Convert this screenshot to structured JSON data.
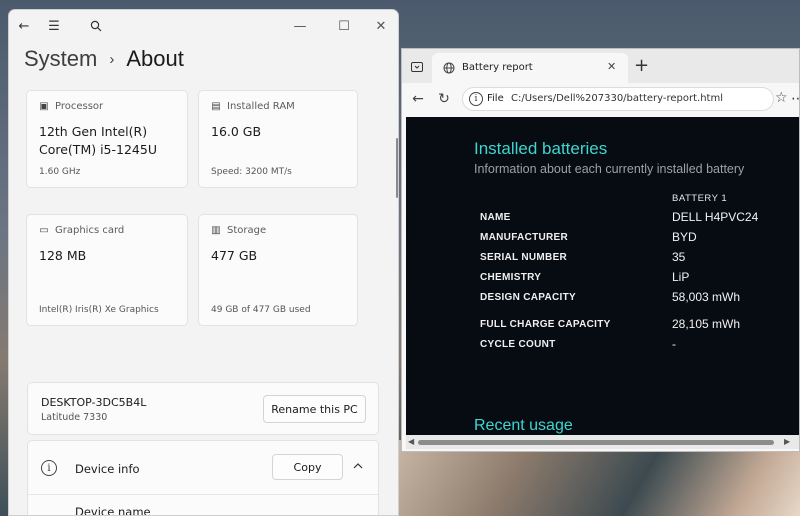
{
  "settings": {
    "breadcrumb_parent": "System",
    "breadcrumb_sep": "›",
    "breadcrumb_current": "About",
    "processor": {
      "label": "Processor",
      "value_line1": "12th Gen Intel(R)",
      "value_line2": "Core(TM) i5-1245U",
      "sub": "1.60 GHz"
    },
    "ram": {
      "label": "Installed RAM",
      "value": "16.0 GB",
      "sub": "Speed: 3200 MT/s"
    },
    "graphics": {
      "label": "Graphics card",
      "value": "128 MB",
      "sub": "Intel(R) Iris(R) Xe Graphics"
    },
    "storage": {
      "label": "Storage",
      "value": "477 GB",
      "sub": "49 GB of 477 GB used"
    },
    "pc_name": "DESKTOP-3DC5B4L",
    "pc_model": "Latitude 7330",
    "rename_button": "Rename this PC",
    "device_info_title": "Device info",
    "copy_button": "Copy",
    "device_name_label": "Device name"
  },
  "browser": {
    "tab_title": "Battery report",
    "address_protocol": "File",
    "address_url": "C:/Users/Dell%207330/battery-report.html",
    "page": {
      "heading": "Installed batteries",
      "subtitle": "Information about each currently installed battery",
      "battery_column": "BATTERY 1",
      "rows": [
        {
          "label": "NAME",
          "value": "DELL H4PVC24"
        },
        {
          "label": "MANUFACTURER",
          "value": "BYD"
        },
        {
          "label": "SERIAL NUMBER",
          "value": "35"
        },
        {
          "label": "CHEMISTRY",
          "value": "LiP"
        },
        {
          "label": "DESIGN CAPACITY",
          "value": "58,003 mWh"
        },
        {
          "label": "FULL CHARGE CAPACITY",
          "value": "28,105 mWh"
        },
        {
          "label": "CYCLE COUNT",
          "value": "-"
        }
      ],
      "next_heading": "Recent usage"
    }
  },
  "colors": {
    "report_accent": "#3ed6d0",
    "report_bg": "#070b12"
  }
}
